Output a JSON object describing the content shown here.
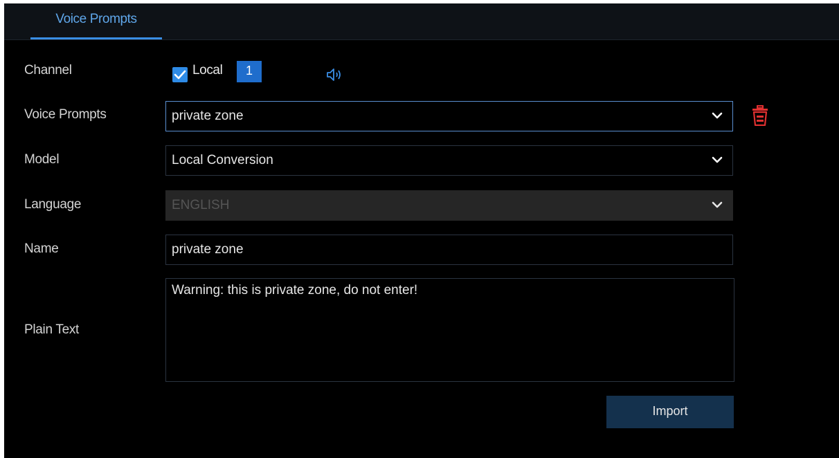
{
  "tabs": [
    {
      "label": "Voice Prompts",
      "active": true
    }
  ],
  "labels": {
    "channel": "Channel",
    "voice_prompts": "Voice Prompts",
    "model": "Model",
    "language": "Language",
    "name": "Name",
    "plain_text": "Plain Text"
  },
  "channel": {
    "checkbox_checked": true,
    "local_label": "Local",
    "number": "1",
    "icon": "speaker-icon"
  },
  "voice_prompts": {
    "selected": "private zone",
    "icon": "chevron-down-icon",
    "delete_icon": "trash-icon"
  },
  "model": {
    "selected": "Local Conversion",
    "icon": "chevron-down-icon"
  },
  "language": {
    "selected": "ENGLISH",
    "disabled": true,
    "icon": "chevron-down-icon"
  },
  "name": {
    "value": "private zone"
  },
  "plain_text": {
    "value": "Warning: this is private zone, do not enter!"
  },
  "buttons": {
    "import": "Import"
  },
  "colors": {
    "accent": "#3a8ee6",
    "background": "#000000",
    "tab_bar": "#0e1217",
    "delete": "#e03030",
    "button": "#14314d"
  }
}
